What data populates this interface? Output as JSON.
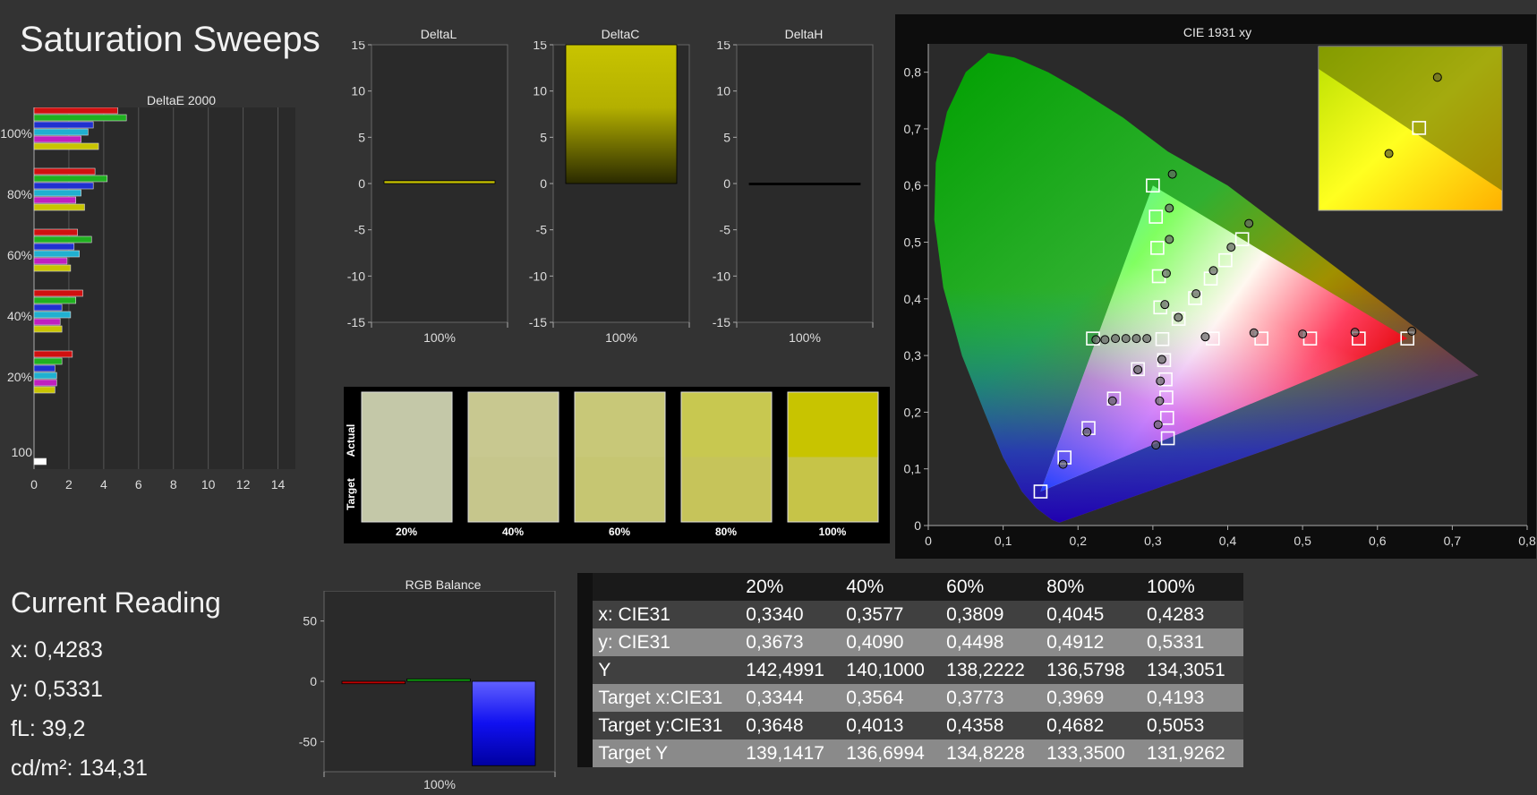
{
  "title": "Saturation Sweeps",
  "colors": {
    "background": "#333333",
    "plot_bg": "#2a2a2a",
    "yellow": "#c8c400",
    "red": "#c00000",
    "green": "#10a010",
    "blue": "#2020e0"
  },
  "current_reading": {
    "title": "Current Reading",
    "x": "x: 0,4283",
    "y": "y: 0,5331",
    "fl": "fL: 39,2",
    "cdm2": "cd/m²: 134,31"
  },
  "chart_data": [
    {
      "type": "bar",
      "title": "DeltaE 2000",
      "orientation": "horizontal",
      "xlim": [
        0,
        15
      ],
      "x_ticks": [
        "0",
        "2",
        "4",
        "6",
        "8",
        "10",
        "12",
        "14"
      ],
      "group_labels": [
        "100%",
        "80%",
        "60%",
        "40%",
        "20%",
        "100"
      ],
      "series_colors": [
        "#d01010",
        "#20b020",
        "#2030d0",
        "#20b0d0",
        "#c020c0",
        "#c8c400"
      ],
      "groups": [
        {
          "label": "100%",
          "values": [
            4.8,
            5.3,
            3.4,
            3.1,
            2.7,
            3.7
          ]
        },
        {
          "label": "80%",
          "values": [
            3.5,
            4.2,
            3.4,
            2.7,
            2.4,
            2.9
          ]
        },
        {
          "label": "60%",
          "values": [
            2.5,
            3.3,
            2.3,
            2.6,
            1.9,
            2.1
          ]
        },
        {
          "label": "40%",
          "values": [
            2.8,
            2.4,
            1.6,
            2.1,
            1.5,
            1.6
          ]
        },
        {
          "label": "20%",
          "values": [
            2.2,
            1.6,
            1.2,
            1.3,
            1.3,
            1.2
          ]
        },
        {
          "label": "100",
          "values": [
            0.7
          ]
        }
      ]
    },
    {
      "type": "bar",
      "title": "DeltaL",
      "categories": [
        "100%"
      ],
      "values": [
        0.3
      ],
      "ylim": [
        -15,
        15
      ],
      "y_ticks": [
        "15",
        "10",
        "5",
        "0",
        "-5",
        "-10",
        "-15"
      ]
    },
    {
      "type": "bar",
      "title": "DeltaC",
      "categories": [
        "100%"
      ],
      "values": [
        15
      ],
      "ylim": [
        -15,
        15
      ],
      "y_ticks": [
        "15",
        "10",
        "5",
        "0",
        "-5",
        "-10",
        "-15"
      ]
    },
    {
      "type": "bar",
      "title": "DeltaH",
      "categories": [
        "100%"
      ],
      "values": [
        0.05
      ],
      "ylim": [
        -15,
        15
      ],
      "y_ticks": [
        "15",
        "10",
        "5",
        "0",
        "-5",
        "-10",
        "-15"
      ]
    },
    {
      "type": "bar",
      "title": "RGB Balance",
      "categories": [
        "100%"
      ],
      "series": [
        {
          "color": "#c00000",
          "values": [
            -2
          ]
        },
        {
          "color": "#10a010",
          "values": [
            2
          ]
        },
        {
          "color": "#2020e0",
          "values": [
            -70
          ]
        }
      ],
      "ylim": [
        -75,
        75
      ],
      "y_ticks": [
        "50",
        "0",
        "-50"
      ]
    },
    {
      "type": "scatter",
      "title": "CIE 1931 xy",
      "xlim": [
        0,
        0.8
      ],
      "ylim": [
        0,
        0.85
      ],
      "x_ticks": [
        "0",
        "0,1",
        "0,2",
        "0,3",
        "0,4",
        "0,5",
        "0,6",
        "0,7",
        "0,8"
      ],
      "y_ticks": [
        "0",
        "0,1",
        "0,2",
        "0,3",
        "0,4",
        "0,5",
        "0,6",
        "0,7",
        "0,8"
      ],
      "gamut": {
        "red": [
          0.64,
          0.33
        ],
        "green": [
          0.3,
          0.6
        ],
        "blue": [
          0.15,
          0.06
        ],
        "white": [
          0.3127,
          0.329
        ]
      },
      "targets": [
        [
          0.3,
          0.6
        ],
        [
          0.304,
          0.545
        ],
        [
          0.306,
          0.49
        ],
        [
          0.308,
          0.44
        ],
        [
          0.31,
          0.385
        ],
        [
          0.15,
          0.06
        ],
        [
          0.182,
          0.12
        ],
        [
          0.214,
          0.172
        ],
        [
          0.248,
          0.224
        ],
        [
          0.28,
          0.276
        ],
        [
          0.64,
          0.33
        ],
        [
          0.575,
          0.33
        ],
        [
          0.51,
          0.33
        ],
        [
          0.445,
          0.33
        ],
        [
          0.38,
          0.33
        ],
        [
          0.32,
          0.154
        ],
        [
          0.319,
          0.19
        ],
        [
          0.318,
          0.226
        ],
        [
          0.317,
          0.258
        ],
        [
          0.315,
          0.292
        ],
        [
          0.22,
          0.33
        ],
        [
          0.3127,
          0.329
        ],
        [
          0.4193,
          0.5053
        ],
        [
          0.3969,
          0.4682
        ],
        [
          0.3773,
          0.4358
        ],
        [
          0.3564,
          0.4013
        ],
        [
          0.3344,
          0.3648
        ]
      ],
      "measured": [
        [
          0.326,
          0.62
        ],
        [
          0.322,
          0.56
        ],
        [
          0.322,
          0.505
        ],
        [
          0.318,
          0.445
        ],
        [
          0.316,
          0.39
        ],
        [
          0.18,
          0.108
        ],
        [
          0.212,
          0.165
        ],
        [
          0.246,
          0.22
        ],
        [
          0.28,
          0.275
        ],
        [
          0.646,
          0.343
        ],
        [
          0.57,
          0.341
        ],
        [
          0.5,
          0.338
        ],
        [
          0.435,
          0.34
        ],
        [
          0.37,
          0.333
        ],
        [
          0.304,
          0.142
        ],
        [
          0.307,
          0.178
        ],
        [
          0.309,
          0.22
        ],
        [
          0.31,
          0.255
        ],
        [
          0.312,
          0.293
        ],
        [
          0.224,
          0.328
        ],
        [
          0.236,
          0.328
        ],
        [
          0.25,
          0.33
        ],
        [
          0.264,
          0.33
        ],
        [
          0.278,
          0.33
        ],
        [
          0.292,
          0.33
        ],
        [
          0.4283,
          0.5331
        ],
        [
          0.4045,
          0.4912
        ],
        [
          0.3809,
          0.4498
        ],
        [
          0.3577,
          0.409
        ],
        [
          0.334,
          0.3673
        ]
      ],
      "inset": {
        "target": [
          0.4193,
          0.5053
        ],
        "measured": [
          [
            0.4283,
            0.5331
          ],
          [
            0.4045,
            0.4912
          ]
        ]
      }
    },
    {
      "type": "table",
      "columns": [
        "",
        "20%",
        "40%",
        "60%",
        "80%",
        "100%"
      ],
      "rows": [
        [
          "x: CIE31",
          "0,3340",
          "0,3577",
          "0,3809",
          "0,4045",
          "0,4283"
        ],
        [
          "y: CIE31",
          "0,3673",
          "0,4090",
          "0,4498",
          "0,4912",
          "0,5331"
        ],
        [
          "Y",
          "142,4991",
          "140,1000",
          "138,2222",
          "136,5798",
          "134,3051"
        ],
        [
          "Target x:CIE31",
          "0,3344",
          "0,3564",
          "0,3773",
          "0,3969",
          "0,4193"
        ],
        [
          "Target y:CIE31",
          "0,3648",
          "0,4013",
          "0,4358",
          "0,4682",
          "0,5053"
        ],
        [
          "Target Y",
          "139,1417",
          "136,6994",
          "134,8228",
          "133,3500",
          "131,9262"
        ]
      ]
    }
  ],
  "swatches": {
    "labels": [
      "20%",
      "40%",
      "60%",
      "80%",
      "100%"
    ],
    "side_actual": "Actual",
    "side_target": "Target",
    "actual": [
      "#c4c8a8",
      "#c8c890",
      "#c8c878",
      "#c8c850",
      "#c8c400"
    ],
    "target": [
      "#c4c8a8",
      "#c6c68c",
      "#c6c672",
      "#c6c45a",
      "#c6c448"
    ]
  }
}
